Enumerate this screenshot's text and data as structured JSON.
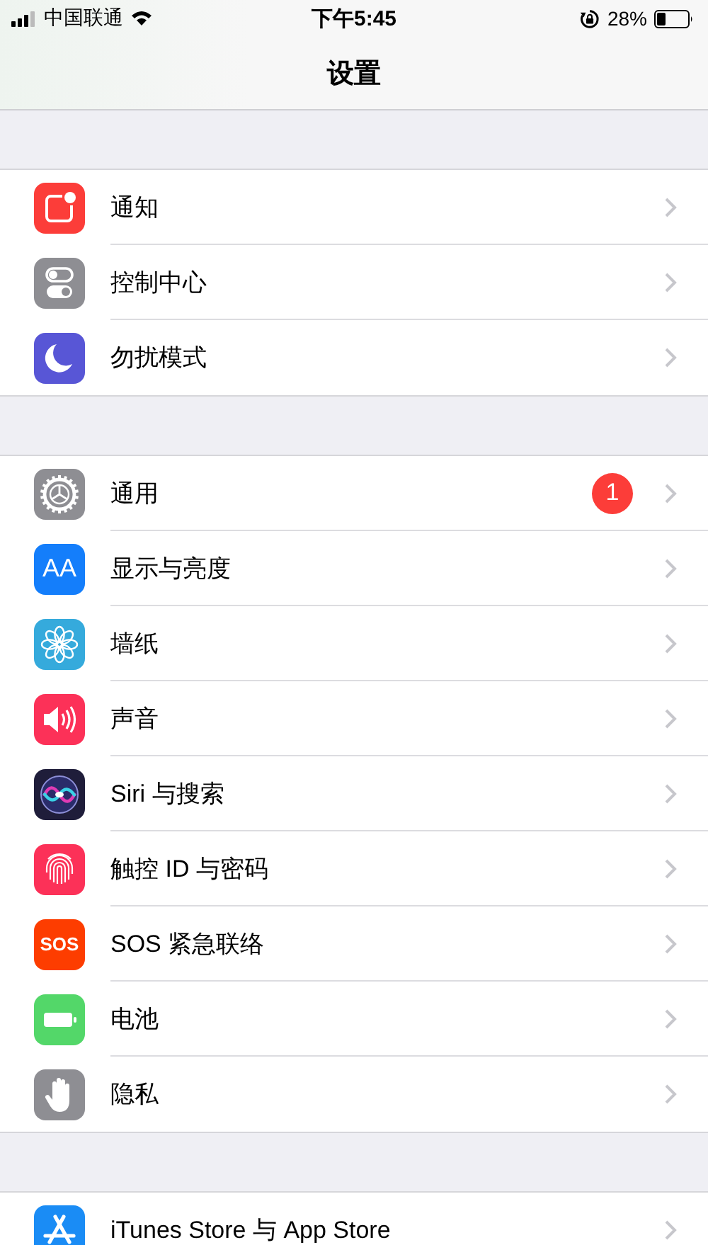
{
  "status_bar": {
    "carrier": "中国联通",
    "time": "下午5:45",
    "battery_percent": "28%"
  },
  "nav_bar": {
    "title": "设置"
  },
  "groups": [
    {
      "rows": [
        {
          "label": "通知",
          "kind": "notification",
          "color": "#fc3d39"
        },
        {
          "label": "控制中心",
          "kind": "toggles",
          "color": "#8e8e93"
        },
        {
          "label": "勿扰模式",
          "kind": "moon",
          "color": "#5856d6"
        }
      ]
    },
    {
      "rows": [
        {
          "label": "通用",
          "kind": "gear",
          "color": "#8e8e93",
          "badge": "1"
        },
        {
          "label": "显示与亮度",
          "kind": "text",
          "color": "#147efb",
          "icon_text": "AA"
        },
        {
          "label": "墙纸",
          "kind": "flower",
          "color": "#35aadc"
        },
        {
          "label": "声音",
          "kind": "speaker",
          "color": "#fc3158"
        },
        {
          "label": "Siri 与搜索",
          "kind": "orb",
          "color": "#1f1d3a"
        },
        {
          "label": "触控 ID 与密码",
          "kind": "fingerprint",
          "color": "#fc3158"
        },
        {
          "label": "SOS 紧急联络",
          "kind": "text",
          "color": "#fd3d00",
          "icon_text": "SOS"
        },
        {
          "label": "电池",
          "kind": "battery",
          "color": "#53d769"
        },
        {
          "label": "隐私",
          "kind": "hand",
          "color": "#8e8e93"
        }
      ]
    },
    {
      "rows": [
        {
          "label": "iTunes Store 与 App Store",
          "kind": "appstore",
          "color": "#1a8cf5"
        }
      ]
    }
  ]
}
